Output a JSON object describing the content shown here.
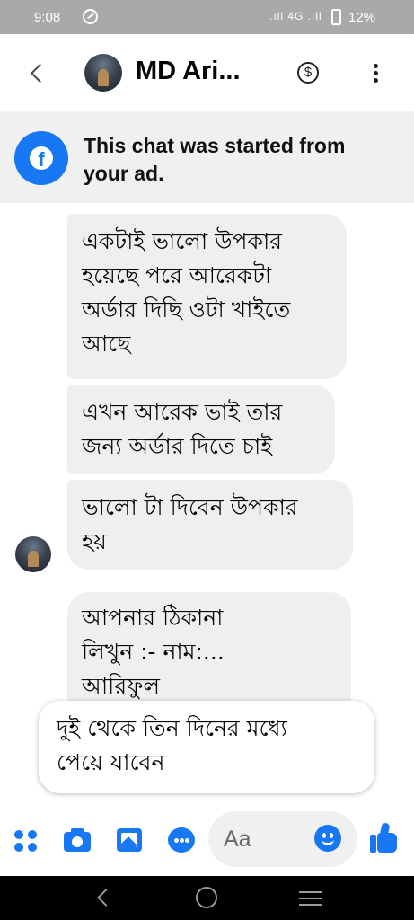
{
  "status_bar": {
    "time": "9:08",
    "signal_text": ".ıll 4G .ıll",
    "battery": "12%"
  },
  "header": {
    "contact_name": "MD Ari...",
    "payment_symbol": "$"
  },
  "ad_banner": {
    "logo_letter": "f",
    "text": "This chat was started from your ad."
  },
  "messages": [
    {
      "lines": [
        "একটাই ভালো উপকার",
        "হয়েছে পরে আরেকটা",
        "অর্ডার দিছি ওটা খাইতে",
        "আছে"
      ]
    },
    {
      "lines": [
        "এখন আরেক ভাই তার",
        "জন্য অর্ডার দিতে চাই"
      ]
    },
    {
      "lines": [
        "ভালো টা দিবেন উপকার",
        "হয়"
      ]
    },
    {
      "lines": [
        "আপনার ঠিকানা",
        "লিখুন :- নাম:...",
        "আরিফুল"
      ]
    }
  ],
  "suggested_reply": {
    "lines": [
      "দুই থেকে তিন দিনের মধ্যে",
      "পেয়ে যাবেন"
    ]
  },
  "composer": {
    "placeholder": "Aa"
  },
  "colors": {
    "accent": "#1877f2",
    "bubble": "#efefef",
    "status_bar": "#a9a9a9",
    "banner": "#f0f0f0"
  }
}
